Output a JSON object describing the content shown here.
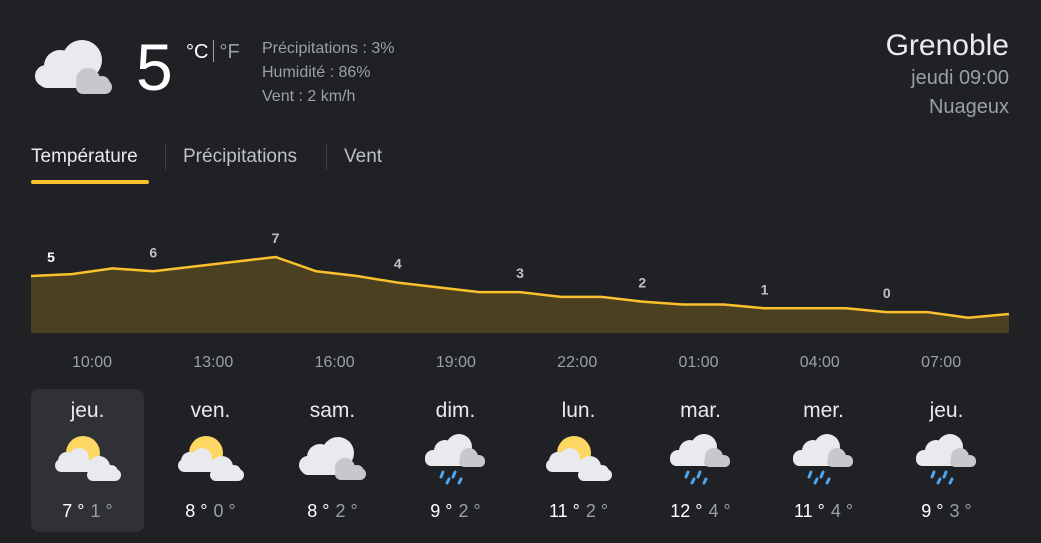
{
  "current": {
    "icon": "cloudy-icon",
    "temperature": "5",
    "unit_c": "°C",
    "unit_f": "°F",
    "precipitation": "Précipitations : 3%",
    "humidity": "Humidité : 86%",
    "wind": "Vent : 2 km/h"
  },
  "location": {
    "city": "Grenoble",
    "time": "jeudi 09:00",
    "condition": "Nuageux"
  },
  "tabs": {
    "temperature": "Température",
    "precipitation": "Précipitations",
    "wind": "Vent"
  },
  "colors": {
    "line": "#fbc02d",
    "fill": "#4b4120",
    "background": "#202124"
  },
  "chart_data": {
    "type": "area",
    "x": [
      "09:00",
      "10:00",
      "11:00",
      "12:00",
      "13:00",
      "14:00",
      "15:00",
      "16:00",
      "17:00",
      "18:00",
      "19:00",
      "20:00",
      "21:00",
      "22:00",
      "23:00",
      "00:00",
      "01:00",
      "02:00",
      "03:00",
      "04:00",
      "05:00",
      "06:00",
      "07:00",
      "08:00",
      "08:30"
    ],
    "values": [
      5,
      5.2,
      5.8,
      5.5,
      6,
      6.5,
      7,
      5.5,
      5,
      4.3,
      3.8,
      3.3,
      3.3,
      2.8,
      2.8,
      2.3,
      2,
      2,
      1.6,
      1.6,
      1.6,
      1.2,
      1.2,
      0.6,
      1
    ],
    "data_labels": [
      {
        "x": "09:00",
        "label": "5"
      },
      {
        "x": "12:00",
        "label": "6"
      },
      {
        "x": "15:00",
        "label": "7"
      },
      {
        "x": "18:00",
        "label": "4"
      },
      {
        "x": "21:00",
        "label": "3"
      },
      {
        "x": "00:00",
        "label": "2"
      },
      {
        "x": "03:00",
        "label": "1"
      },
      {
        "x": "06:00",
        "label": "0"
      }
    ],
    "tick_labels": [
      "10:00",
      "13:00",
      "16:00",
      "19:00",
      "22:00",
      "01:00",
      "04:00",
      "07:00"
    ],
    "ylim": [
      -6,
      12
    ]
  },
  "days": [
    {
      "name": "jeu.",
      "icon": "partly-cloudy-icon",
      "hi": "7 °",
      "lo": "1 °"
    },
    {
      "name": "ven.",
      "icon": "partly-cloudy-icon",
      "hi": "8 °",
      "lo": "0 °"
    },
    {
      "name": "sam.",
      "icon": "cloudy-icon",
      "hi": "8 °",
      "lo": "2 °"
    },
    {
      "name": "dim.",
      "icon": "rain-icon",
      "hi": "9 °",
      "lo": "2 °"
    },
    {
      "name": "lun.",
      "icon": "partly-cloudy-icon",
      "hi": "11 °",
      "lo": "2 °"
    },
    {
      "name": "mar.",
      "icon": "rain-icon",
      "hi": "12 °",
      "lo": "4 °"
    },
    {
      "name": "mer.",
      "icon": "rain-icon",
      "hi": "11 °",
      "lo": "4 °"
    },
    {
      "name": "jeu.",
      "icon": "rain-icon",
      "hi": "9 °",
      "lo": "3 °"
    }
  ]
}
